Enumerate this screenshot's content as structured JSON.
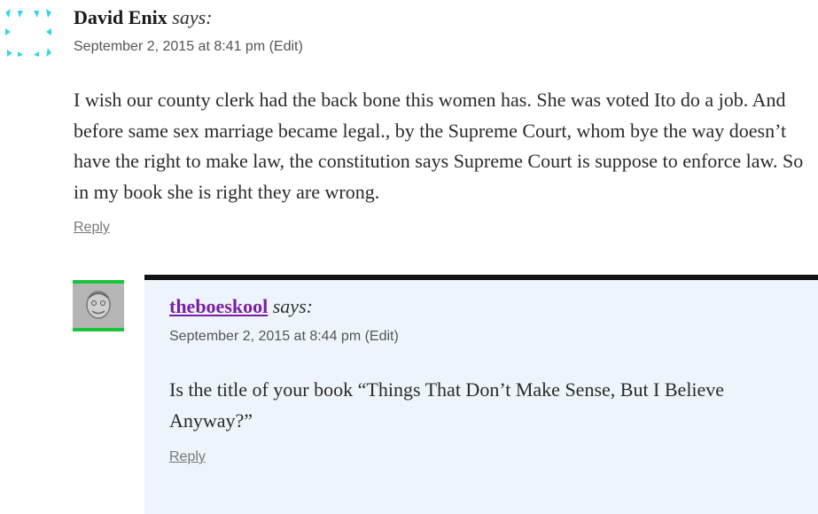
{
  "comments": [
    {
      "author": "David Enix",
      "says": "says:",
      "date": "September 2, 2015 at 8:41 pm",
      "edit": "(Edit)",
      "body": "I wish our county clerk had the back bone this women has. She was voted Ito do a job. And before same sex marriage became legal., by the Supreme Court, whom bye the way doesn’t have the right to make law, the constitution says Supreme Court is suppose to enforce law. So in my book she is right they are wrong.",
      "reply": "Reply",
      "avatar_color": "#33d6e8"
    },
    {
      "author": "theboeskool",
      "says": "says:",
      "date": "September 2, 2015 at 8:44 pm",
      "edit": "(Edit)",
      "body": "Is the title of your book “Things That Don’t Make Sense, But I Believe Anyway?”",
      "reply": "Reply",
      "author_color": "#7b1fa2",
      "avatar_accent": "#19c43a",
      "box_background": "#eef4fb"
    }
  ]
}
